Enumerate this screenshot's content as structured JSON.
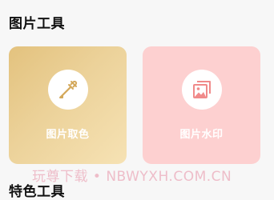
{
  "sections": [
    {
      "title": "图片工具"
    },
    {
      "title": "特色工具"
    }
  ],
  "tools": [
    {
      "label": "图片取色",
      "icon": "eyedropper-icon",
      "bg": "#e8c98a",
      "icon_color": "#d4a95c"
    },
    {
      "label": "图片水印",
      "icon": "image-watermark-icon",
      "bg": "#fdd0d0",
      "icon_color": "#f08a8a"
    }
  ],
  "overlay_watermark": "玩尊下载 • NBWYXH.COM.CN"
}
